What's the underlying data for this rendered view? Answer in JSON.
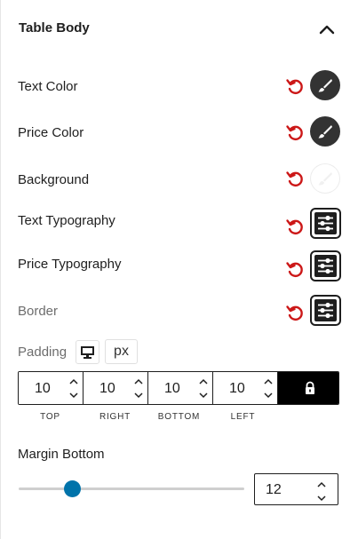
{
  "section": {
    "title": "Table Body",
    "collapse_icon": "chevron-up-icon"
  },
  "rows": [
    {
      "label": "Text Color",
      "control": "color",
      "value": "#333333"
    },
    {
      "label": "Price Color",
      "control": "color",
      "value": "#333333"
    },
    {
      "label": "Background",
      "control": "color",
      "value": "#ffffff"
    },
    {
      "label": "Text Typography",
      "control": "typography"
    },
    {
      "label": "Price Typography",
      "control": "typography"
    },
    {
      "label": "Border",
      "control": "typography"
    }
  ],
  "reset_icon": "reset-icon",
  "reset_color": "#cc1818",
  "padding": {
    "label": "Padding",
    "device_icon": "desktop-icon",
    "unit": "px",
    "values": [
      {
        "value": "10",
        "label": "TOP"
      },
      {
        "value": "10",
        "label": "RIGHT"
      },
      {
        "value": "10",
        "label": "BOTTOM"
      },
      {
        "value": "10",
        "label": "LEFT"
      }
    ],
    "link_icon": "lock-icon"
  },
  "margin_bottom": {
    "label": "Margin Bottom",
    "value": "12",
    "slider_fraction": 0.24,
    "accent": "#0073aa"
  }
}
